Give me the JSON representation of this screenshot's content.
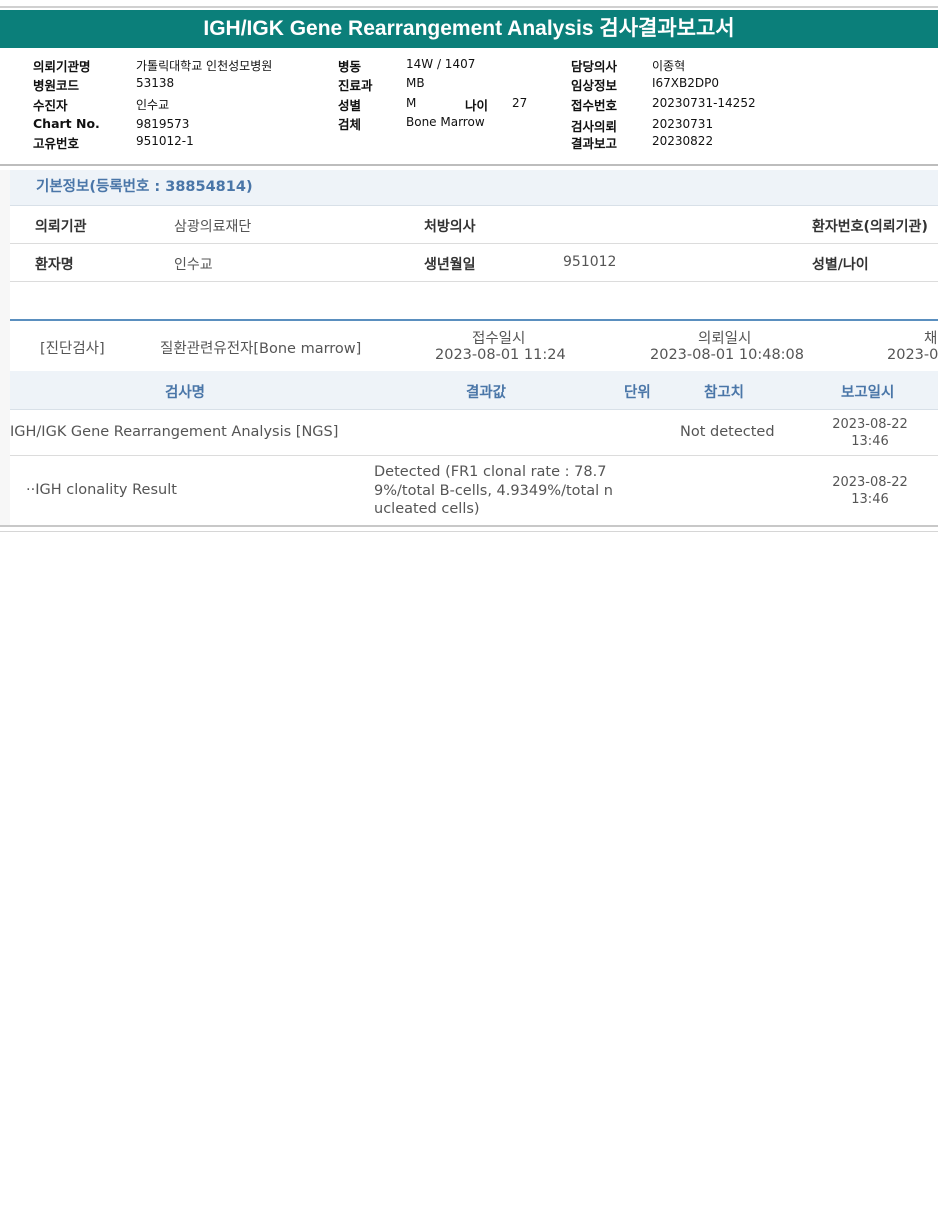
{
  "title": "IGH/IGK Gene Rearrangement Analysis 검사결과보고서",
  "header": {
    "col1": [
      {
        "label": "의뢰기관명",
        "value": "가톨릭대학교 인천성모병원"
      },
      {
        "label": "병원코드",
        "value": "53138"
      },
      {
        "label": "수진자",
        "value": "인수교"
      },
      {
        "label": "Chart No.",
        "value": "9819573"
      },
      {
        "label": "고유번호",
        "value": "951012-1"
      }
    ],
    "col2": [
      {
        "label": "병동",
        "value": "14W / 1407"
      },
      {
        "label": "진료과",
        "value": "MB"
      },
      {
        "label": "성별",
        "value": "M"
      },
      {
        "label": "검체",
        "value": "Bone Marrow"
      }
    ],
    "age_label": "나이",
    "age_value": "27",
    "col3": [
      {
        "label": "담당의사",
        "value": "이종혁"
      },
      {
        "label": "임상정보",
        "value": "I67XB2DP0"
      },
      {
        "label": "접수번호",
        "value": "20230731-14252"
      },
      {
        "label": "검사의뢰",
        "value": "20230731"
      },
      {
        "label": "결과보고",
        "value": "20230822"
      }
    ]
  },
  "basic_info": {
    "heading": "기본정보(등록번호 : 38854814)",
    "row1": {
      "l1": "의뢰기관",
      "v1": "삼광의료재단",
      "l2": "처방의사",
      "v2": "",
      "l3": "환자번호(의뢰기관)"
    },
    "row2": {
      "l1": "환자명",
      "v1": "인수교",
      "l2": "생년월일",
      "v2": "951012",
      "l3": "성별/나이"
    }
  },
  "exam": {
    "category": "[진단검사]",
    "name": "질환관련유전자[Bone marrow]",
    "received_label": "접수일시",
    "received_value": "2023-08-01 11:24",
    "requested_label": "의뢰일시",
    "requested_value": "2023-08-01 10:48:08",
    "cut_label": "채",
    "cut_value": "2023-0"
  },
  "columns": {
    "name": "검사명",
    "result": "결과값",
    "unit": "단위",
    "reference": "참고치",
    "report": "보고일시"
  },
  "results": [
    {
      "name": "IGH/IGK Gene Rearrangement Analysis [NGS]",
      "result": "",
      "unit": "",
      "reference": "Not detected",
      "date": "2023-08-22",
      "time": "13:46"
    },
    {
      "name": "··IGH clonality Result",
      "result_lines": [
        "Detected (FR1 clonal rate : 78.7",
        "9%/total B-cells, 4.9349%/total n",
        "ucleated cells)"
      ],
      "unit": "",
      "reference": "",
      "date": "2023-08-22",
      "time": "13:46"
    }
  ]
}
